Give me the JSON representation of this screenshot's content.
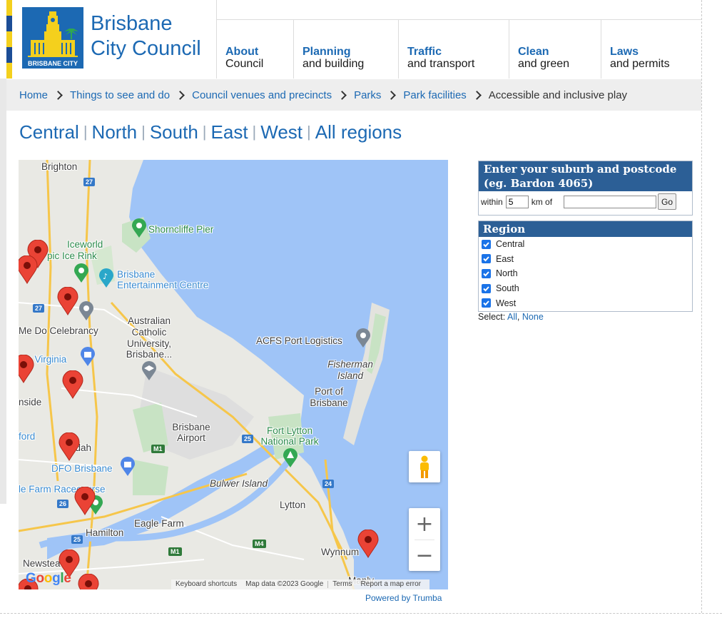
{
  "header": {
    "logo_caption": "BRISBANE CITY",
    "site_name_line1": "Brisbane",
    "site_name_line2": "City Council",
    "brand_color": "#1c69b3",
    "accent_color": "#f4d01d"
  },
  "nav": [
    {
      "line1": "About",
      "line2": "Council"
    },
    {
      "line1": "Planning",
      "line2": "and building"
    },
    {
      "line1": "Traffic",
      "line2": "and transport"
    },
    {
      "line1": "Clean",
      "line2": "and green"
    },
    {
      "line1": "Laws",
      "line2": "and permits"
    }
  ],
  "breadcrumb": {
    "items": [
      "Home",
      "Things to see and do",
      "Council venues and precincts",
      "Parks",
      "Park facilities"
    ],
    "current": "Accessible and inclusive play"
  },
  "regions": [
    "Central",
    "North",
    "South",
    "East",
    "West",
    "All regions"
  ],
  "map": {
    "labels": {
      "brighton": "Brighton",
      "shorncliffe": "Shorncliffe Pier",
      "iceworld1": "Iceworld",
      "iceworld2": "pic Ice Rink",
      "ent1": "Brisbane",
      "ent2": "Entertainment Centre",
      "acu1": "Australian",
      "acu2": "Catholic",
      "acu3": "University,",
      "acu4": "Brisbane...",
      "celebrancy": "Me Do Celebrancy",
      "virginia": "s Virginia",
      "acfs": "ACFS Port Logistics",
      "fisherman1": "Fisherman",
      "fisherman2": "Island",
      "port1": "Port of",
      "port2": "Brisbane",
      "nside": "nside",
      "airport1": "Brisbane",
      "airport2": "Airport",
      "fortlytton1": "Fort Lytton",
      "fortlytton2": "National Park",
      "ford": "ford",
      "ndah": "ndah",
      "dfo": "DFO Brisbane",
      "racecourse": "le Farm Racecourse",
      "bulwer": "Bulwer Island",
      "lytton": "Lytton",
      "eaglefarm": "Eagle Farm",
      "hamilton": "Hamilton",
      "wynnum": "Wynnum",
      "newstead": "Newstea",
      "manly": "Manly"
    },
    "shields": {
      "s27a": "27",
      "s27b": "27",
      "s26": "26",
      "s25a": "25",
      "s25b": "25",
      "s24": "24",
      "sM1a": "M1",
      "sM1b": "M1",
      "sM4": "M4"
    },
    "attribution": {
      "shortcuts": "Keyboard shortcuts",
      "data": "Map data ©2023 Google",
      "terms": "Terms",
      "report": "Report a map error"
    },
    "zoom_in": "+",
    "zoom_out": "−",
    "google_letters": [
      "G",
      "o",
      "o",
      "g",
      "l",
      "e"
    ],
    "water_color": "#9fc4f7",
    "land_color": "#e9e9e4",
    "park_color": "#c8e3c4",
    "pin_color": "#ea4335"
  },
  "powered_by": "Powered by Trumba",
  "search": {
    "heading": "Enter your suburb and postcode (eg. Bardon 4065)",
    "within_label": "within",
    "within_value": "5",
    "km_label": "km of",
    "location_value": "",
    "go_label": "Go"
  },
  "region_filter": {
    "heading": "Region",
    "options": [
      {
        "label": "Central",
        "checked": true
      },
      {
        "label": "East",
        "checked": true
      },
      {
        "label": "North",
        "checked": true
      },
      {
        "label": "South",
        "checked": true
      },
      {
        "label": "West",
        "checked": true
      }
    ],
    "select_label": "Select:",
    "all_label": "All",
    "comma": ",",
    "none_label": "None"
  }
}
